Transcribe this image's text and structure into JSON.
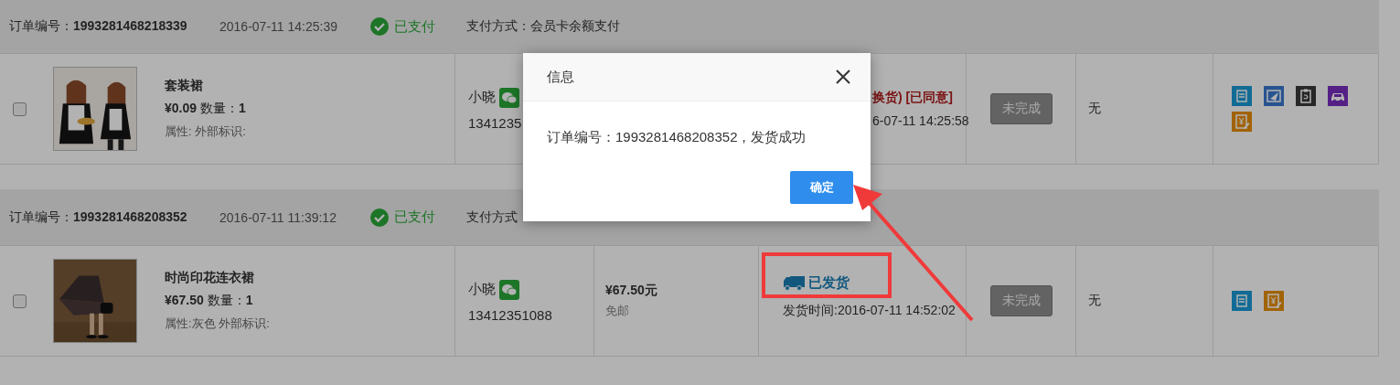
{
  "orders": [
    {
      "order_no": "订单编号：**1993281468218339**",
      "time": "2016-07-11 14:25:39",
      "pay_status": "已支付",
      "pay_method": "支付方式：会员卡余额支付",
      "checked": false,
      "item": {
        "name": "套装裙",
        "price": "**¥0.09** 数量：**1**",
        "attrs": "属性: 外部标识:"
      },
      "buyer": {
        "name": "小晓",
        "phone": "1341235"
      },
      "status": {
        "kind": "return",
        "text": "换货) [已同意]",
        "time": "6-07-11 14:25:58"
      },
      "completion": "未完成",
      "remark": "无",
      "actions": [
        {
          "kind": "note"
        },
        {
          "kind": "edit"
        },
        {
          "kind": "clipboard"
        },
        {
          "kind": "car"
        },
        {
          "kind": "yen"
        }
      ]
    },
    {
      "order_no": "订单编号：**1993281468208352**",
      "time": "2016-07-11 11:39:12",
      "pay_status": "已支付",
      "pay_method": "支付方式",
      "checked": false,
      "item": {
        "name": "时尚印花连衣裙",
        "price": "**¥67.50** 数量：**1**",
        "attrs": "属性:灰色 外部标识:"
      },
      "buyer": {
        "name": "小晓",
        "phone": "13412351088"
      },
      "amount": "¥67.50元",
      "shipping": "免邮",
      "status": {
        "kind": "shipped",
        "text": "已发货",
        "time": "发货时间:2016-07-11 14:52:02"
      },
      "completion": "未完成",
      "remark": "无",
      "actions": [
        {
          "kind": "note"
        },
        {
          "kind": "yen"
        }
      ]
    }
  ],
  "dialog": {
    "title": "信息",
    "message": "订单编号：1993281468208352，发货成功",
    "button": "确定"
  }
}
